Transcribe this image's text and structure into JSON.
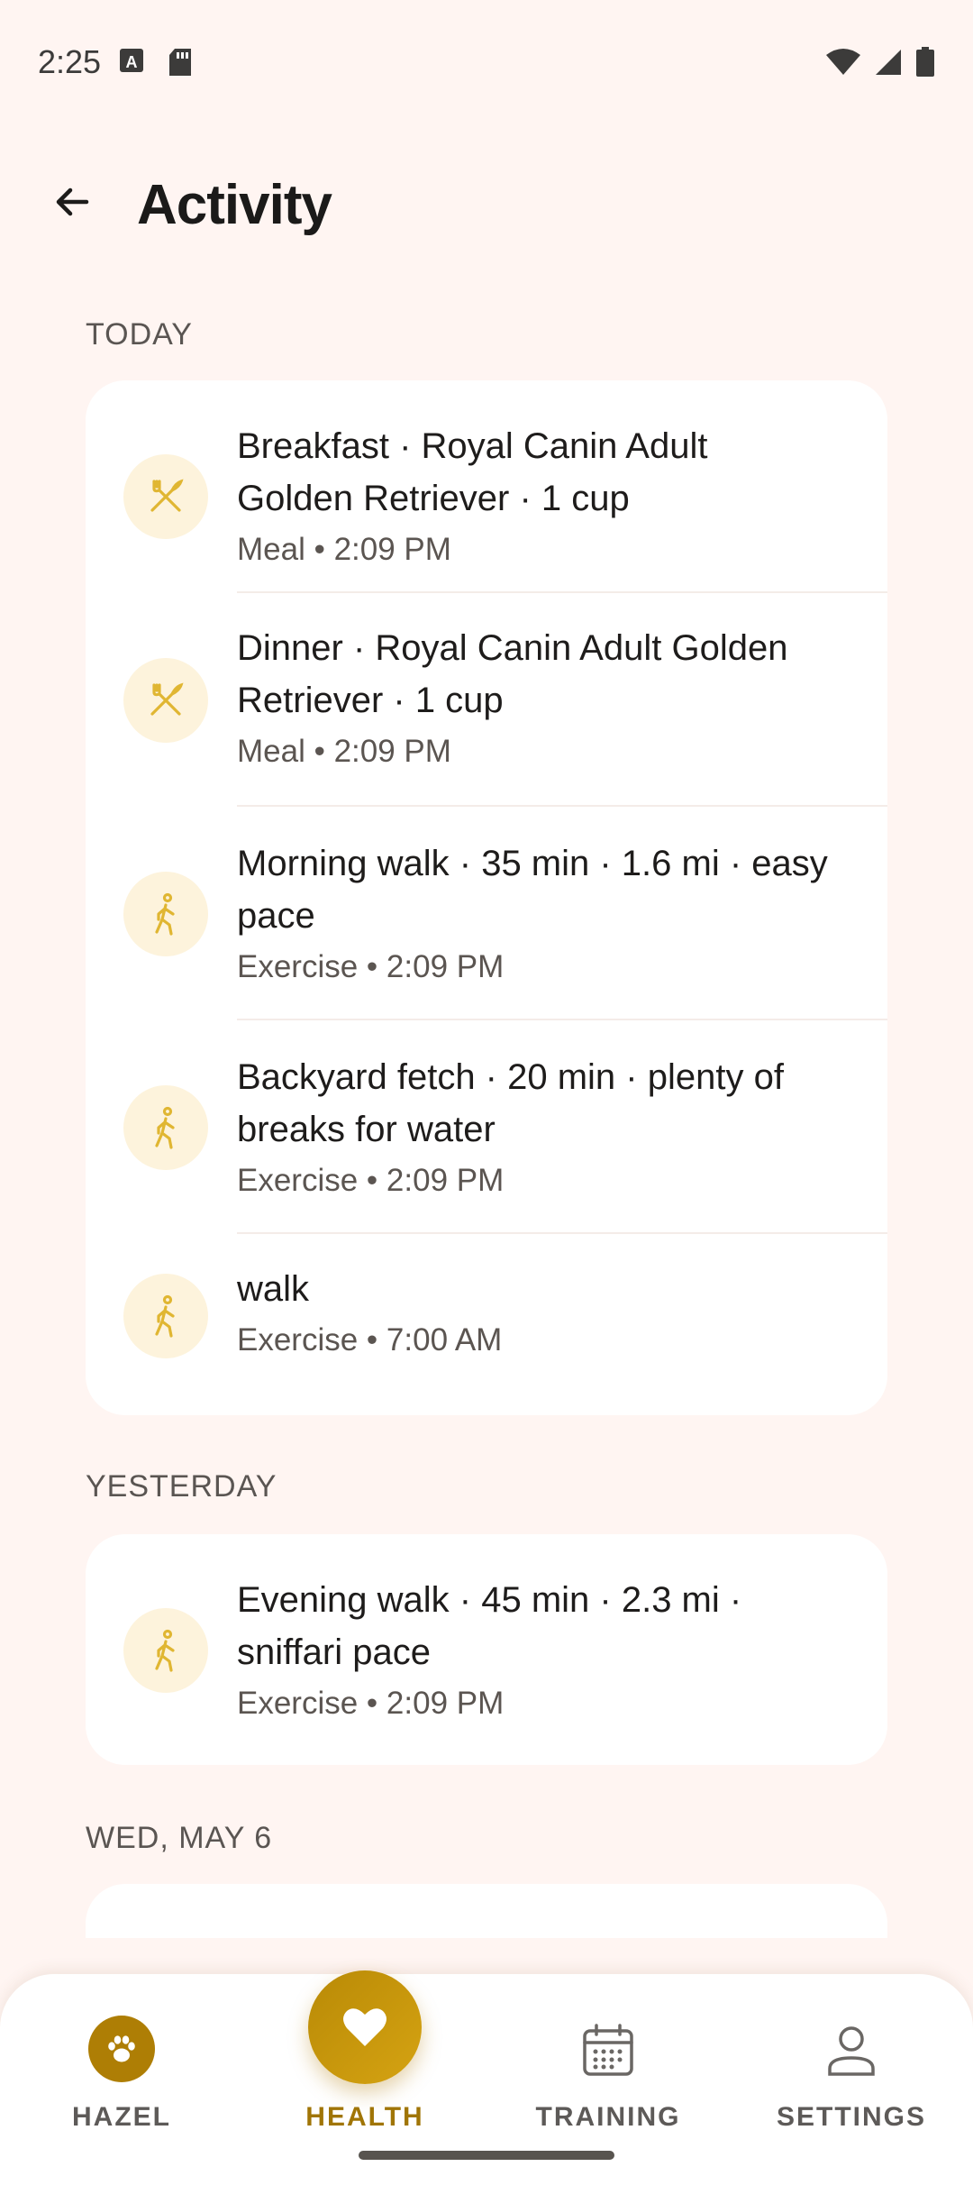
{
  "status_bar": {
    "time": "2:25"
  },
  "header": {
    "title": "Activity"
  },
  "sections": [
    {
      "label": "TODAY",
      "entries": [
        {
          "icon": "fork-knife-icon",
          "title": "Breakfast · Royal Canin Adult Golden Retriever · 1 cup",
          "meta": "Meal • 2:09 PM"
        },
        {
          "icon": "fork-knife-icon",
          "title": "Dinner · Royal Canin Adult Golden Retriever · 1 cup",
          "meta": "Meal • 2:09 PM"
        },
        {
          "icon": "walk-icon",
          "title": "Morning walk · 35 min · 1.6 mi · easy pace",
          "meta": "Exercise • 2:09 PM"
        },
        {
          "icon": "walk-icon",
          "title": "Backyard fetch · 20 min · plenty of breaks for water",
          "meta": "Exercise • 2:09 PM"
        },
        {
          "icon": "walk-icon",
          "title": "walk",
          "meta": "Exercise • 7:00 AM"
        }
      ]
    },
    {
      "label": "YESTERDAY",
      "entries": [
        {
          "icon": "walk-icon",
          "title": "Evening walk · 45 min · 2.3 mi · sniffari pace",
          "meta": "Exercise • 2:09 PM"
        }
      ]
    },
    {
      "label": "WED, MAY 6",
      "entries": []
    }
  ],
  "bottom_nav": {
    "items": [
      {
        "label": "HAZEL",
        "icon": "paw-icon"
      },
      {
        "label": "HEALTH",
        "icon": "heart-icon",
        "active": true
      },
      {
        "label": "TRAINING",
        "icon": "calendar-icon"
      },
      {
        "label": "SETTINGS",
        "icon": "person-icon"
      }
    ]
  },
  "colors": {
    "accent": "#B8860B",
    "icon_bg": "#FDF3DC",
    "background": "#FFF5F2"
  }
}
